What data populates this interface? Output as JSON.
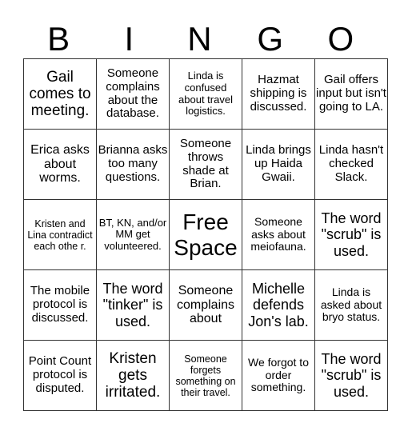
{
  "header": {
    "letters": [
      "B",
      "I",
      "N",
      "G",
      "O"
    ]
  },
  "grid": {
    "rows": [
      [
        "Gail comes to meeting.",
        "Someone complains about the database.",
        "Linda is confused about travel logistics.",
        "Hazmat shipping is discussed.",
        "Gail offers input but isn't going to LA."
      ],
      [
        "Erica asks about worms.",
        "Brianna asks too many questions.",
        "Someone throws shade at Brian.",
        "Linda brings up Haida Gwaii.",
        "Linda hasn't checked Slack."
      ],
      [
        "Kristen and Lina contradict each othe r.",
        "BT, KN, and/or MM get volunteered.",
        "Free Space",
        "Someone asks about meiofauna.",
        "The word \"scrub\" is used."
      ],
      [
        "The mobile protocol is discussed.",
        "The word \"tinker\" is used.",
        "Someone complains about",
        "Michelle defends Jon's lab.",
        "Linda is asked about bryo status."
      ],
      [
        "Point Count protocol is disputed.",
        "Kristen gets irritated.",
        "Someone forgets something on their travel.",
        "We forgot to order something.",
        "The word \"scrub\" is used."
      ]
    ]
  }
}
